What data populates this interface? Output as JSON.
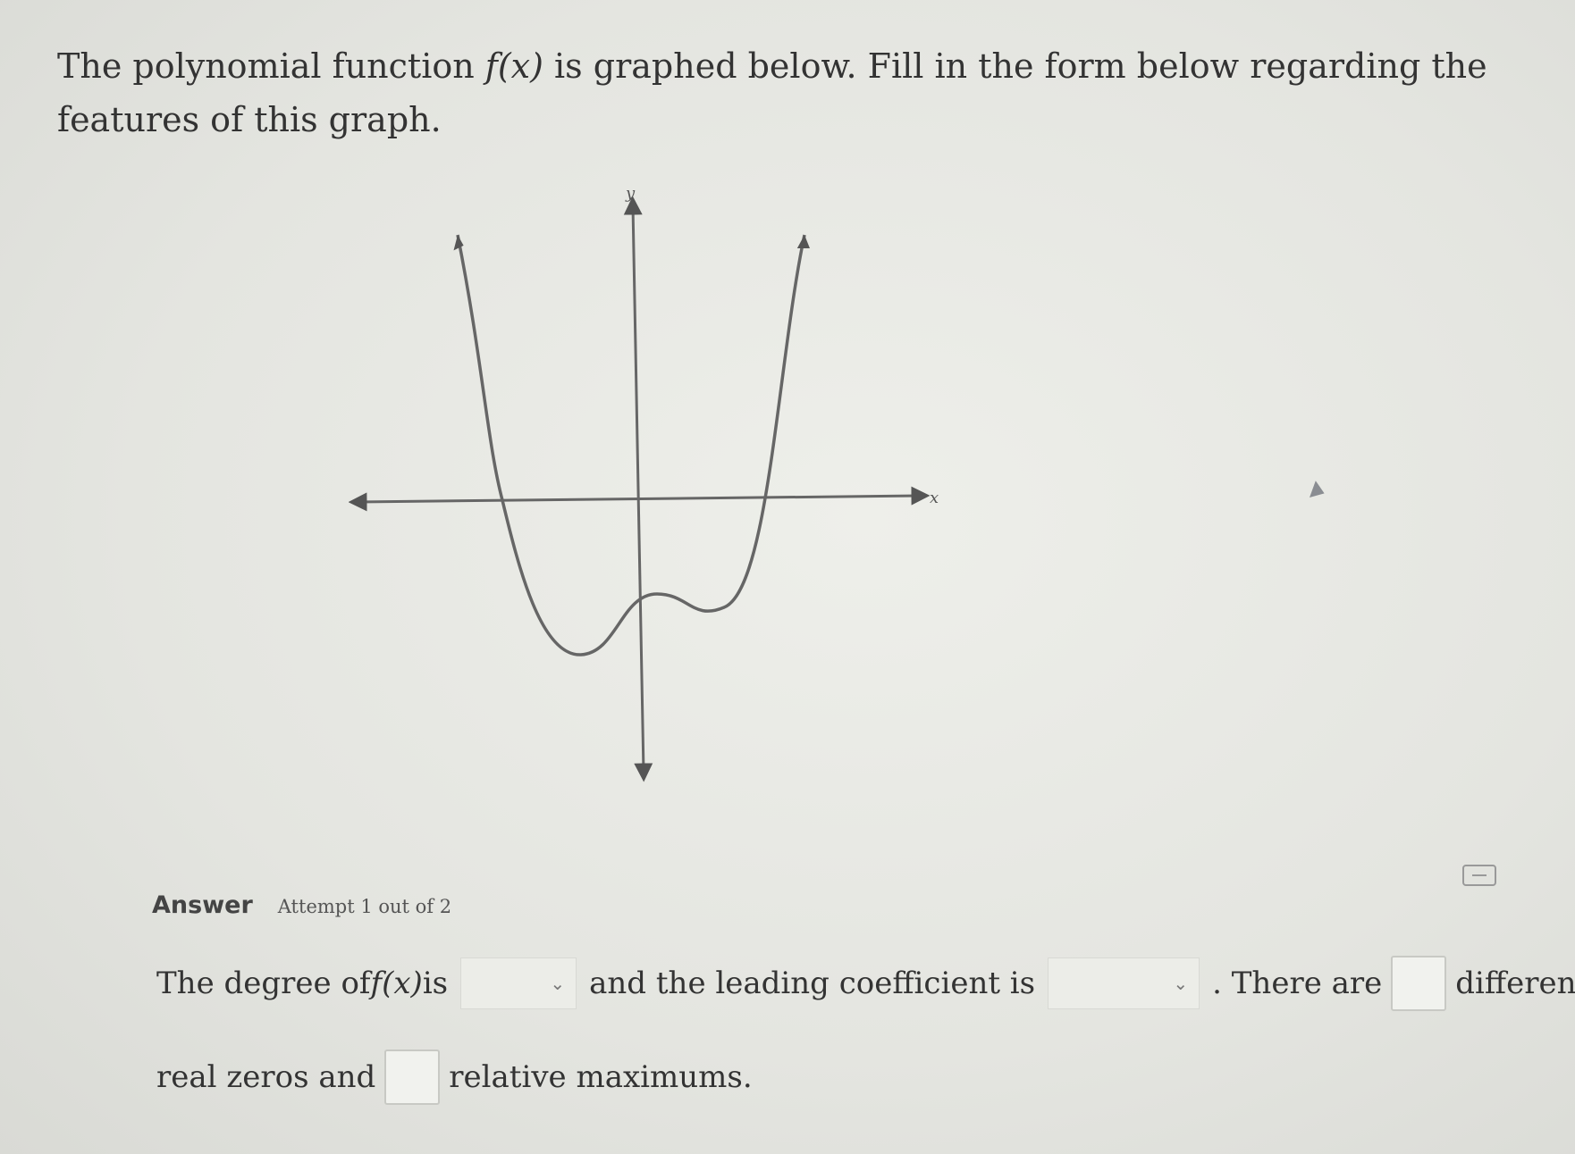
{
  "question": {
    "text_before": "The polynomial function ",
    "math": "f(x)",
    "text_after": " is graphed below. Fill in the form below regarding the features of this graph."
  },
  "graph": {
    "x_axis_label": "x",
    "y_axis_label": "y"
  },
  "answer": {
    "label": "Answer",
    "attempt": "Attempt 1 out of 2"
  },
  "form": {
    "part1": "The degree of ",
    "math": "f(x)",
    "part2": " is",
    "part3": "and the leading coefficient is",
    "part4": ". There are",
    "part5": "different",
    "part6": "real zeros and",
    "part7": "relative maximums.",
    "degree_select_value": "",
    "coefficient_select_value": "",
    "zeros_input_value": "",
    "maximums_input_value": ""
  },
  "icons": {
    "dropdown": "chevron-down-icon",
    "calculator": "calculator-icon",
    "cursor": "mouse-cursor-icon"
  }
}
